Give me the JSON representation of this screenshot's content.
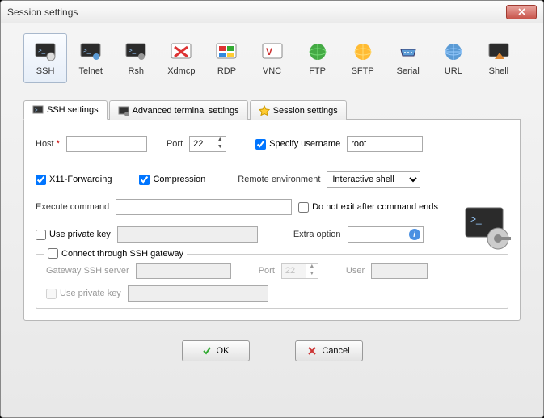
{
  "title": "Session settings",
  "types": {
    "ssh": "SSH",
    "telnet": "Telnet",
    "rsh": "Rsh",
    "xdmcp": "Xdmcp",
    "rdp": "RDP",
    "vnc": "VNC",
    "ftp": "FTP",
    "sftp": "SFTP",
    "serial": "Serial",
    "url": "URL",
    "shell": "Shell"
  },
  "tabs": {
    "ssh": "SSH settings",
    "adv": "Advanced terminal settings",
    "sess": "Session settings"
  },
  "form": {
    "host_label": "Host",
    "port_label": "Port",
    "port_value": "22",
    "specify_user": "Specify username",
    "user_value": "root",
    "x11": "X11-Forwarding",
    "compression": "Compression",
    "remote_env_label": "Remote environment",
    "remote_env_value": "Interactive shell",
    "exec_cmd": "Execute command",
    "no_exit": "Do not exit after command ends",
    "use_pk": "Use private key",
    "extra_opt": "Extra option",
    "gateway": {
      "title": "Connect through SSH gateway",
      "server": "Gateway SSH server",
      "port": "Port",
      "port_value": "22",
      "user": "User",
      "use_pk": "Use private key"
    }
  },
  "buttons": {
    "ok": "OK",
    "cancel": "Cancel"
  }
}
